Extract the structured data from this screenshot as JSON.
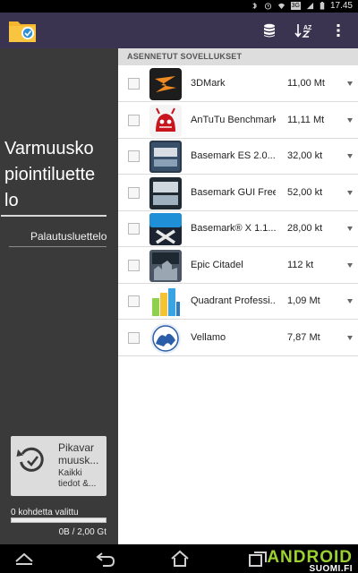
{
  "status_bar": {
    "time": "17.45",
    "icons": [
      "bluetooth-icon",
      "alarm-icon",
      "wifi-icon",
      "3g-icon",
      "signal-icon",
      "battery-icon"
    ],
    "network_badge": "3G"
  },
  "action_bar": {
    "background": "#3b3450",
    "app_icon": "backup-folder-icon",
    "actions": [
      "storage-icon",
      "sort-icon",
      "overflow-menu-icon"
    ],
    "sort_label": "AZ"
  },
  "left_panel": {
    "title": "Varmuuskopiointiluettelo",
    "title_lines": [
      "Varmuusko",
      "piointiluette",
      "lo"
    ],
    "restore_list_link": "Palautusluettelo",
    "quick_backup": {
      "label": "Pikavar muusk...",
      "label_lines": [
        "Pikavar",
        "muusk..."
      ],
      "sublabel": "Kaikki tiedot &...",
      "sublabel_lines": [
        "Kaikki",
        "tiedot &..."
      ]
    },
    "selected_count": "0 kohdetta valittu",
    "selected_size": "0B / 2,00 Gt",
    "selected_fraction": 0
  },
  "right_panel": {
    "section_header": "ASENNETUT SOVELLUKSET",
    "apps": [
      {
        "name": "3DMark",
        "size": "11,00 Mt",
        "icon": "3dmark-icon",
        "checked": false
      },
      {
        "name": "AnTuTu Benchmark",
        "size": "11,11 Mt",
        "icon": "antutu-icon",
        "checked": false
      },
      {
        "name": "Basemark ES 2.0...",
        "size": "32,00 kt",
        "icon": "basemark-es2-icon",
        "checked": false
      },
      {
        "name": "Basemark GUI Free",
        "size": "52,00 kt",
        "icon": "basemark-gui-icon",
        "checked": false
      },
      {
        "name": "Basemark® X 1.1...",
        "size": "28,00 kt",
        "icon": "basemark-x-icon",
        "checked": false
      },
      {
        "name": "Epic Citadel",
        "size": "112 kt",
        "icon": "epic-citadel-icon",
        "checked": false
      },
      {
        "name": "Quadrant Professi...",
        "size": "1,09 Mt",
        "icon": "quadrant-icon",
        "checked": false
      },
      {
        "name": "Vellamo",
        "size": "7,87 Mt",
        "icon": "vellamo-icon",
        "checked": false
      }
    ]
  },
  "nav_bar": {
    "buttons": [
      "back-icon",
      "home-icon",
      "recent-apps-icon",
      "screenshot-icon"
    ],
    "watermark_big": "ANDROID",
    "watermark_small": "SUOMI.FI"
  }
}
